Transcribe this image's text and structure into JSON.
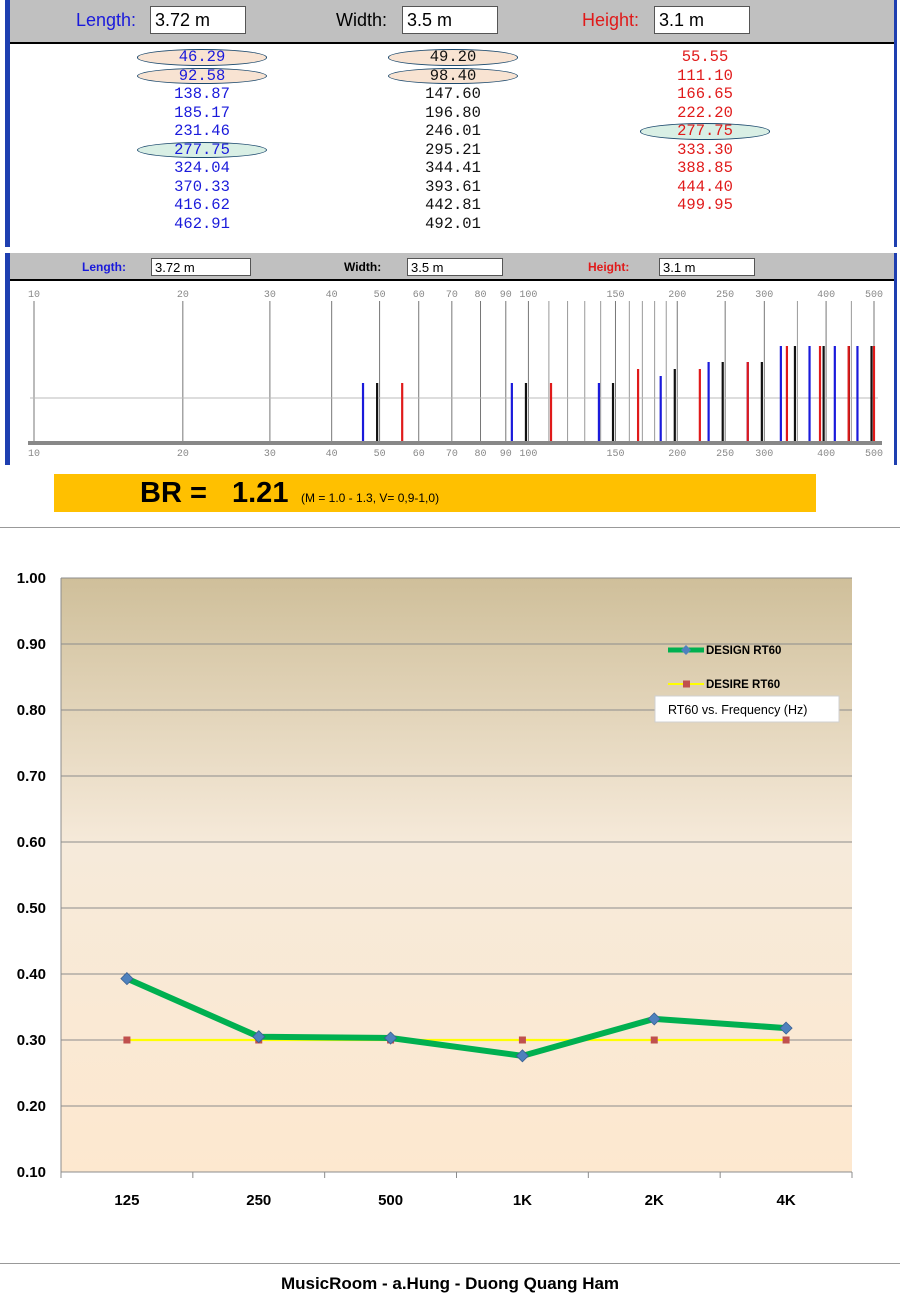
{
  "room": {
    "length_label": "Length:",
    "length_value": "3.72 m",
    "width_label": "Width:",
    "width_value": "3.5 m",
    "height_label": "Height:",
    "height_value": "3.1 m"
  },
  "modes": {
    "length": [
      "46.29",
      "92.58",
      "138.87",
      "185.17",
      "231.46",
      "277.75",
      "324.04",
      "370.33",
      "416.62",
      "462.91"
    ],
    "width": [
      "49.20",
      "98.40",
      "147.60",
      "196.80",
      "246.01",
      "295.21",
      "344.41",
      "393.61",
      "442.81",
      "492.01"
    ],
    "height": [
      "55.55",
      "111.10",
      "166.65",
      "222.20",
      "277.75",
      "333.30",
      "388.85",
      "444.40",
      "499.95"
    ],
    "highlight_length": [
      0,
      1,
      5
    ],
    "highlight_width": [
      0,
      1
    ],
    "highlight_height": [
      4
    ],
    "colors": {
      "length": "#1a1adb",
      "width": "#111111",
      "height": "#e01a1a"
    }
  },
  "freq_axis": {
    "ticks": [
      10,
      20,
      30,
      40,
      50,
      60,
      70,
      80,
      90,
      100,
      150,
      200,
      250,
      300,
      400,
      500
    ],
    "tick_labels": [
      "10",
      "20",
      "30",
      "40",
      "50",
      "60",
      "70",
      "80",
      "90",
      "100",
      "150",
      "200",
      "250",
      "300",
      "400",
      "500"
    ]
  },
  "br": {
    "label": "BR =",
    "value": "1.21",
    "note": "(M = 1.0 - 1.3, V= 0,9-1,0)"
  },
  "chart_data": {
    "type": "line",
    "categories": [
      "125",
      "250",
      "500",
      "1K",
      "2K",
      "4K"
    ],
    "series": [
      {
        "name": "DESIGN RT60",
        "values": [
          0.393,
          0.305,
          0.303,
          0.276,
          0.332,
          0.318
        ],
        "color": "#00b050",
        "marker_color": "#4f81bd"
      },
      {
        "name": "DESIRE RT60",
        "values": [
          0.3,
          0.3,
          0.3,
          0.3,
          0.3,
          0.3
        ],
        "color": "#ffff00",
        "marker_color": "#c0504d"
      }
    ],
    "ylim": [
      0.1,
      1.0
    ],
    "yticks": [
      "0.10",
      "0.20",
      "0.30",
      "0.40",
      "0.50",
      "0.60",
      "0.70",
      "0.80",
      "0.90",
      "1.00"
    ],
    "annotation": "RT60  vs.  Frequency (Hz)",
    "legend_position": "top-right",
    "grid": true
  },
  "footer": "MusicRoom - a.Hung - Duong Quang Ham"
}
